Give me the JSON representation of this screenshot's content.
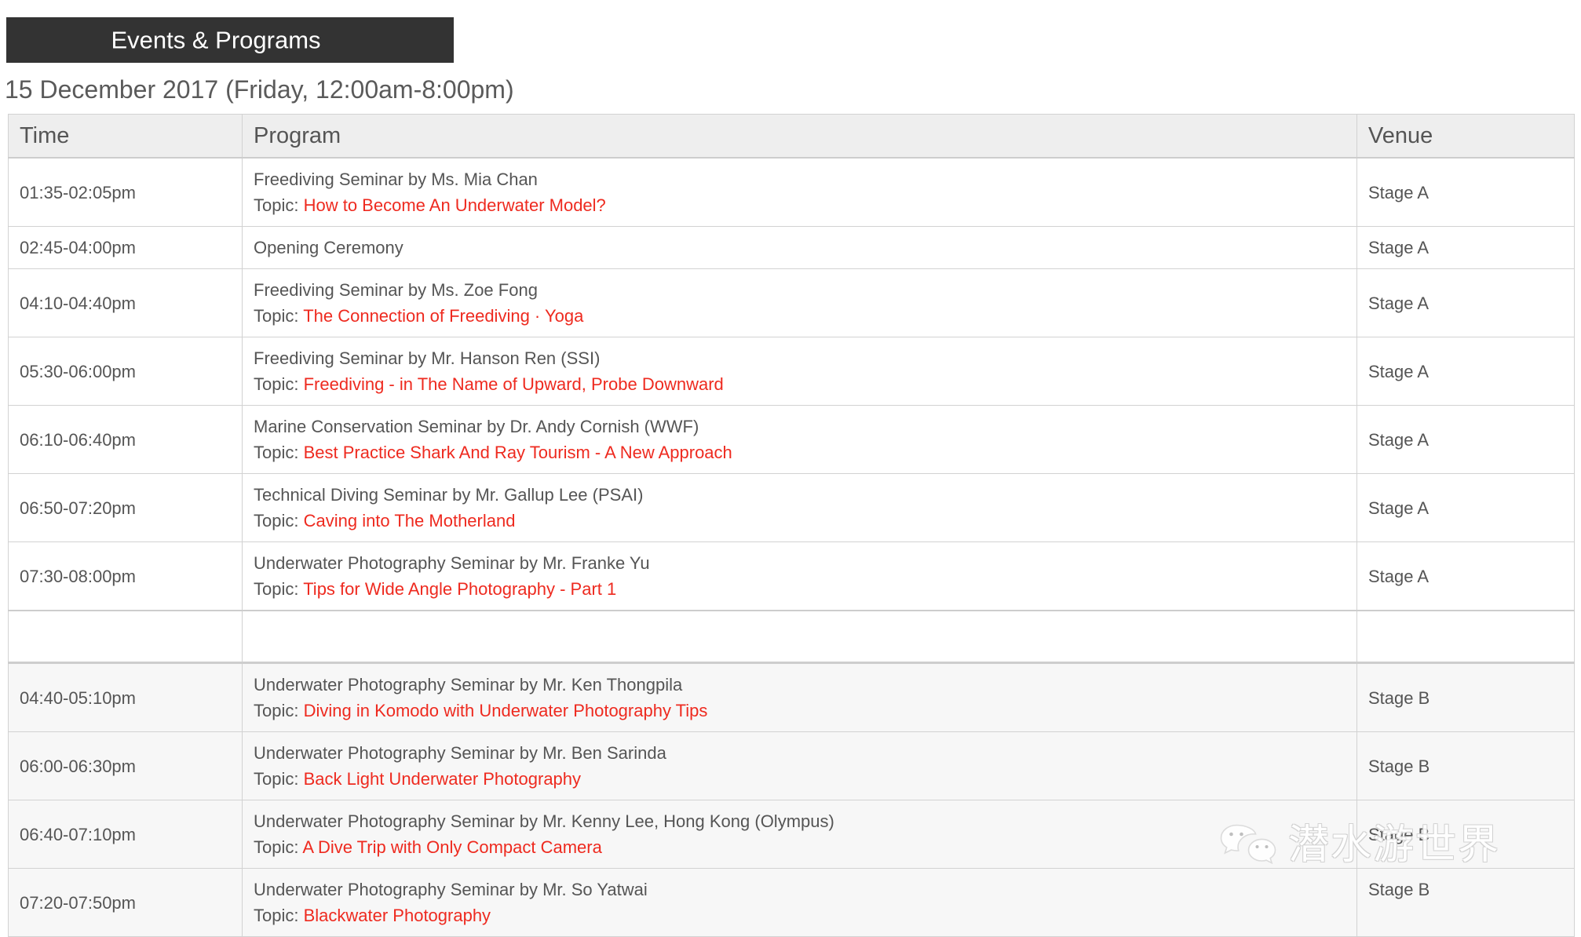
{
  "header": {
    "section_title": "Events & Programs",
    "date_line": "15 December 2017 (Friday, 12:00am-8:00pm)"
  },
  "table": {
    "columns": [
      "Time",
      "Program",
      "Venue"
    ],
    "topic_label": "Topic: ",
    "rows": [
      {
        "time": "01:35-02:05pm",
        "presenter": "Freediving Seminar by Ms. Mia Chan",
        "topic": "How to Become An Underwater Model?",
        "venue": "Stage A",
        "shade": "light"
      },
      {
        "time": "02:45-04:00pm",
        "presenter": "Opening Ceremony",
        "topic": "",
        "venue": "Stage A",
        "shade": "light"
      },
      {
        "time": "04:10-04:40pm",
        "presenter": "Freediving Seminar by Ms. Zoe Fong",
        "topic": "The Connection of Freediving · Yoga",
        "venue": "Stage A",
        "shade": "light"
      },
      {
        "time": "05:30-06:00pm",
        "presenter": "Freediving Seminar by Mr. Hanson Ren (SSI)",
        "topic": "Freediving - in The Name of Upward, Probe Downward",
        "venue": "Stage A",
        "shade": "light"
      },
      {
        "time": "06:10-06:40pm",
        "presenter": "Marine Conservation Seminar by Dr. Andy Cornish (WWF)",
        "topic": "Best Practice Shark And Ray Tourism - A New Approach",
        "venue": "Stage A",
        "shade": "light"
      },
      {
        "time": "06:50-07:20pm",
        "presenter": "Technical Diving Seminar by Mr. Gallup Lee (PSAI)",
        "topic": "Caving into The Motherland",
        "venue": "Stage A",
        "shade": "light"
      },
      {
        "time": "07:30-08:00pm",
        "presenter": "Underwater Photography Seminar by Mr. Franke Yu",
        "topic": "Tips for Wide Angle Photography - Part 1",
        "venue": "Stage A",
        "shade": "light"
      },
      {
        "time": "",
        "presenter": "",
        "topic": "",
        "venue": "",
        "shade": "spacer"
      },
      {
        "time": "04:40-05:10pm",
        "presenter": "Underwater Photography Seminar by Mr. Ken Thongpila",
        "topic": "Diving in Komodo with Underwater Photography Tips",
        "venue": "Stage B",
        "shade": "shade"
      },
      {
        "time": "06:00-06:30pm",
        "presenter": "Underwater Photography Seminar by Mr. Ben Sarinda",
        "topic": "Back Light Underwater Photography",
        "venue": "Stage B",
        "shade": "shade"
      },
      {
        "time": "06:40-07:10pm",
        "presenter": "Underwater Photography Seminar by Mr. Kenny Lee, Hong Kong (Olympus)",
        "topic": "A Dive Trip with Only Compact Camera",
        "venue": "Stage B",
        "shade": "shade"
      },
      {
        "time": "07:20-07:50pm",
        "presenter": "Underwater Photography Seminar by Mr. So Yatwai",
        "topic": "Blackwater Photography",
        "venue": "Stage B",
        "shade": "shade"
      }
    ]
  },
  "watermark": {
    "icon": "wechat-icon",
    "text": "潜水游世界"
  },
  "colors": {
    "title_bar_bg": "#333333",
    "topic_red": "#ee2a1f",
    "body_text": "#555555",
    "header_bg": "#eeeeee",
    "row_shade_bg": "#f7f7f7",
    "border": "#d2d2d2"
  }
}
